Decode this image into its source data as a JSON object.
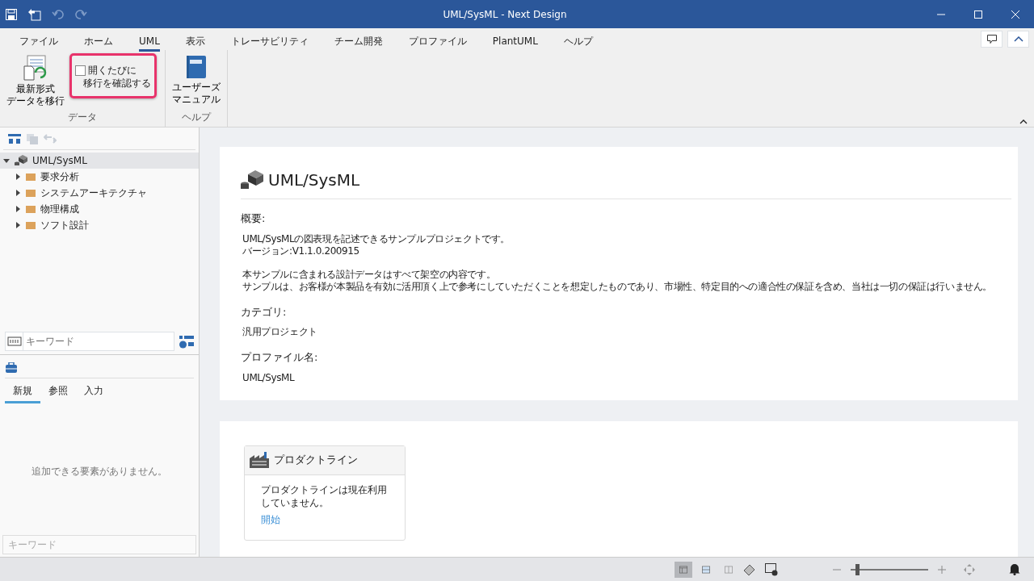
{
  "window": {
    "title": "UML/SysML - Next Design"
  },
  "ribbon_tabs": [
    {
      "label": "ファイル",
      "selected": false
    },
    {
      "label": "ホーム",
      "selected": false
    },
    {
      "label": "UML",
      "selected": true
    },
    {
      "label": "表示",
      "selected": false
    },
    {
      "label": "トレーサビリティ",
      "selected": false
    },
    {
      "label": "チーム開発",
      "selected": false
    },
    {
      "label": "プロファイル",
      "selected": false
    },
    {
      "label": "PlantUML",
      "selected": false
    },
    {
      "label": "ヘルプ",
      "selected": false
    }
  ],
  "ribbon_groups": [
    {
      "label": "データ",
      "items": [
        {
          "kind": "button",
          "lines": [
            "最新形式",
            "データを移行"
          ]
        },
        {
          "kind": "checkbox",
          "lines": [
            "開くたびに",
            "移行を確認する"
          ],
          "checked": false,
          "highlighted": true
        }
      ]
    },
    {
      "label": "ヘルプ",
      "items": [
        {
          "kind": "book",
          "lines": [
            "ユーザーズ",
            "マニュアル"
          ]
        }
      ]
    }
  ],
  "tree": [
    {
      "label": "UML/SysML",
      "expanded": true,
      "selected": true,
      "children": [
        {
          "label": "要求分析",
          "expanded": false,
          "selected": false
        },
        {
          "label": "システムアーキテクチャ",
          "expanded": false,
          "selected": false
        },
        {
          "label": "物理構成",
          "expanded": false,
          "selected": false
        },
        {
          "label": "ソフト設計",
          "expanded": false,
          "selected": false
        }
      ]
    }
  ],
  "tree_search": {
    "placeholder": "キーワード"
  },
  "toolbox_tabs": [
    {
      "label": "新規",
      "selected": true
    },
    {
      "label": "参照",
      "selected": false
    },
    {
      "label": "入力",
      "selected": false
    }
  ],
  "toolbox_empty": "追加できる要素がありません。",
  "toolbox_search": {
    "placeholder": "キーワード"
  },
  "project": {
    "title": "UML/SysML",
    "sections": [
      {
        "heading": "概要:",
        "paragraphs": [
          [
            "UML/SysMLの図表現を記述できるサンプルプロジェクトです。",
            "バージョン:V1.1.0.200915"
          ],
          [
            "本サンプルに含まれる設計データはすべて架空の内容です。",
            "サンプルは、お客様が本製品を有効に活用頂く上で参考にしていただくことを想定したものであり、市場性、特定目的への適合性の保証を含め、当社は一切の保証は行いません。"
          ]
        ]
      },
      {
        "heading": "カテゴリ:",
        "paragraphs": [
          [
            "汎用プロジェクト"
          ]
        ]
      },
      {
        "heading": "プロファイル名:",
        "paragraphs": [
          [
            "UML/SysML"
          ]
        ]
      }
    ]
  },
  "product_line": {
    "title": "プロダクトライン",
    "text": "プロダクトラインは現在利用していません。",
    "link": "開始"
  },
  "status_bar": {
    "layouts": [
      {
        "selected": true
      },
      {
        "selected": false
      },
      {
        "selected": false
      }
    ],
    "zoom": {
      "level": 0.08
    }
  }
}
